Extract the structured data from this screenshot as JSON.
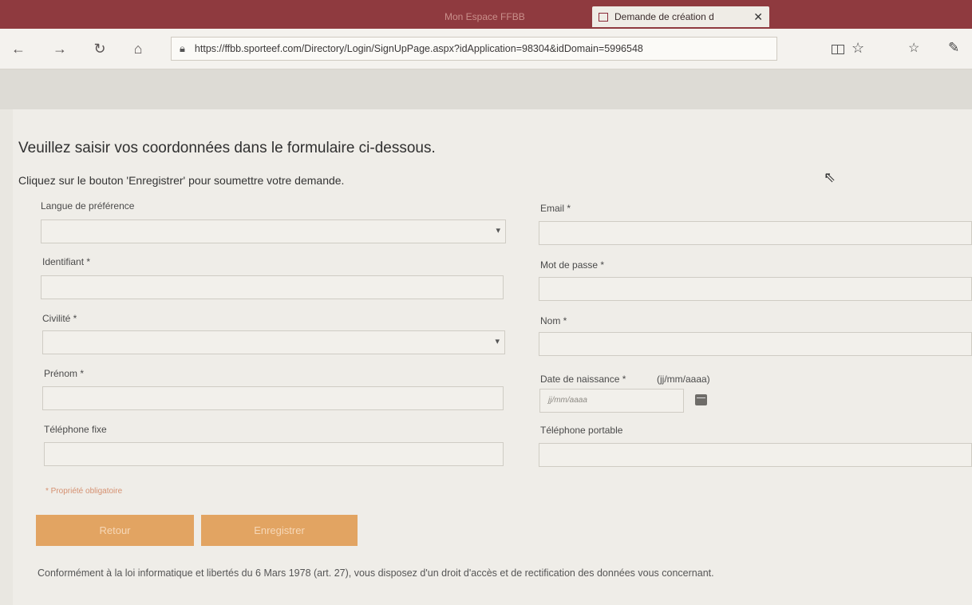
{
  "browser": {
    "tabs": [
      {
        "label": "",
        "active": false
      },
      {
        "label": "",
        "active": false
      },
      {
        "label": "Mon Espace FFBB",
        "active": false
      },
      {
        "label": "Demande de création d",
        "active": true
      }
    ],
    "tab_close": "✕",
    "nav": {
      "back": "←",
      "forward": "→",
      "refresh": "↻",
      "home": "⌂"
    },
    "url": "https://ffbb.sporteef.com/Directory/Login/SignUpPage.aspx?idApplication=98304&idDomain=5996548",
    "icons": [
      "lock-icon",
      "reading-view-icon",
      "star-icon",
      "favorites-icon",
      "pen-icon"
    ]
  },
  "form": {
    "heading": "Veuillez saisir vos coordonnées dans le formulaire ci-dessous.",
    "subheading": "Cliquez sur le bouton 'Enregistrer' pour soumettre votre demande.",
    "fields": {
      "langue": {
        "label": "Langue de préférence",
        "value": ""
      },
      "email": {
        "label": "Email *",
        "value": ""
      },
      "identifiant": {
        "label": "Identifiant *",
        "value": ""
      },
      "mot_de_passe": {
        "label": "Mot de passe *",
        "value": ""
      },
      "civilite": {
        "label": "Civilité *",
        "value": ""
      },
      "nom": {
        "label": "Nom *",
        "value": ""
      },
      "prenom": {
        "label": "Prénom *",
        "value": ""
      },
      "date_naissance": {
        "label": "Date de naissance *",
        "hint": "(jj/mm/aaaa)",
        "placeholder": "jj/mm/aaaa"
      },
      "telephone_fixe": {
        "label": "Téléphone fixe",
        "value": ""
      },
      "telephone_portable": {
        "label": "Téléphone portable",
        "value": ""
      }
    },
    "required_note": "* Propriété obligatoire",
    "buttons": {
      "retour": "Retour",
      "enregistrer": "Enregistrer"
    },
    "legal": "Conformément à la loi informatique et libertés du 6 Mars 1978 (art. 27), vous disposez d'un droit d'accès et de rectification des données vous concernant."
  },
  "colors": {
    "tabbar": "#8f3a3f",
    "button": "#e2a462",
    "required_note": "#d59070"
  }
}
